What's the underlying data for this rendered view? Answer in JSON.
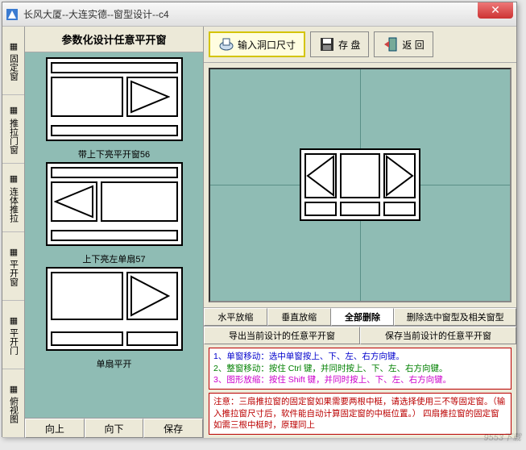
{
  "window": {
    "title": "长风大厦--大连实德--窗型设计--c4"
  },
  "sidebar": {
    "tabs": [
      {
        "label": "固定窗"
      },
      {
        "label": "推拉门窗"
      },
      {
        "label": "连体推拉"
      },
      {
        "label": "平开窗"
      },
      {
        "label": "平开门"
      },
      {
        "label": "俯视图"
      }
    ]
  },
  "left": {
    "header": "参数化设计任意平开窗",
    "items": [
      {
        "caption": "带上下亮平开窗56"
      },
      {
        "caption": "上下亮左单扇57"
      },
      {
        "caption": "单扇平开"
      }
    ],
    "buttons": {
      "up": "向上",
      "down": "向下",
      "save": "保存"
    }
  },
  "toolbar": {
    "input_size": "输入洞口尺寸",
    "save": "存 盘",
    "back": "返 回"
  },
  "actions": {
    "row1": {
      "hscale": "水平放缩",
      "vscale": "垂直放缩",
      "delall": "全部删除",
      "delsel": "删除选中窗型及相关窗型"
    },
    "row2": {
      "export": "导出当前设计的任意平开窗",
      "savecur": "保存当前设计的任意平开窗"
    }
  },
  "hints": {
    "l1": "1、单窗移动：选中单窗按上、下、左、右方向键。",
    "l2": "2、整窗移动：按住 Ctrl 键，并同时按上、下、左、右方向键。",
    "l3": "3、图形放缩：按住 Shift 键，并同时按上、下、左、右方向键。"
  },
  "note": "注意：三扇推拉窗的固定窗如果需要两根中梃，请选择使用三不等固定窗。（输入推拉窗尺寸后，软件能自动计算固定窗的中梃位置。） 四扇推拉窗的固定窗如需三根中梃时，原理同上",
  "watermark": "9553下载"
}
